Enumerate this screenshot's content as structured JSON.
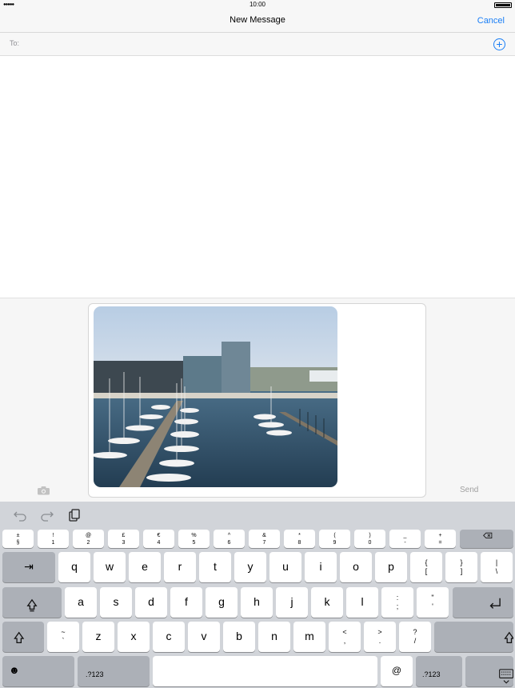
{
  "status_bar": {
    "signal": "●●●●●",
    "time": "10:00"
  },
  "nav": {
    "title": "New Message",
    "cancel_label": "Cancel"
  },
  "recipients": {
    "to_label": "To:",
    "add_label": "+"
  },
  "compose": {
    "attachment_description": "Photo of marina with boats and office buildings",
    "send_label": "Send"
  },
  "keyboard": {
    "number_row": [
      {
        "top": "±",
        "bottom": "§"
      },
      {
        "top": "!",
        "bottom": "1"
      },
      {
        "top": "@",
        "bottom": "2"
      },
      {
        "top": "£",
        "bottom": "3"
      },
      {
        "top": "€",
        "bottom": "4"
      },
      {
        "top": "%",
        "bottom": "5"
      },
      {
        "top": "^",
        "bottom": "6"
      },
      {
        "top": "&",
        "bottom": "7"
      },
      {
        "top": "*",
        "bottom": "8"
      },
      {
        "top": "(",
        "bottom": "9"
      },
      {
        "top": ")",
        "bottom": "0"
      },
      {
        "top": "_",
        "bottom": "-"
      },
      {
        "top": "+",
        "bottom": "="
      }
    ],
    "row1": [
      "q",
      "w",
      "e",
      "r",
      "t",
      "y",
      "u",
      "i",
      "o",
      "p"
    ],
    "row1_extra": [
      {
        "top": "{",
        "bottom": "["
      },
      {
        "top": "}",
        "bottom": "]"
      },
      {
        "top": "|",
        "bottom": "\\"
      }
    ],
    "row2": [
      "a",
      "s",
      "d",
      "f",
      "g",
      "h",
      "j",
      "k",
      "l"
    ],
    "row2_extra": [
      {
        "top": ":",
        "bottom": ";"
      },
      {
        "top": "\"",
        "bottom": "'"
      }
    ],
    "row3_first": {
      "top": "~",
      "bottom": "`"
    },
    "row3": [
      "z",
      "x",
      "c",
      "v",
      "b",
      "n",
      "m"
    ],
    "row3_extra": [
      {
        "top": "<",
        "bottom": ","
      },
      {
        "top": ">",
        "bottom": "."
      },
      {
        "top": "?",
        "bottom": "/"
      }
    ],
    "tab_symbol": "⇥",
    "numbers_label": ".?123",
    "at_label": "@",
    "emoji_symbol": "☻"
  }
}
